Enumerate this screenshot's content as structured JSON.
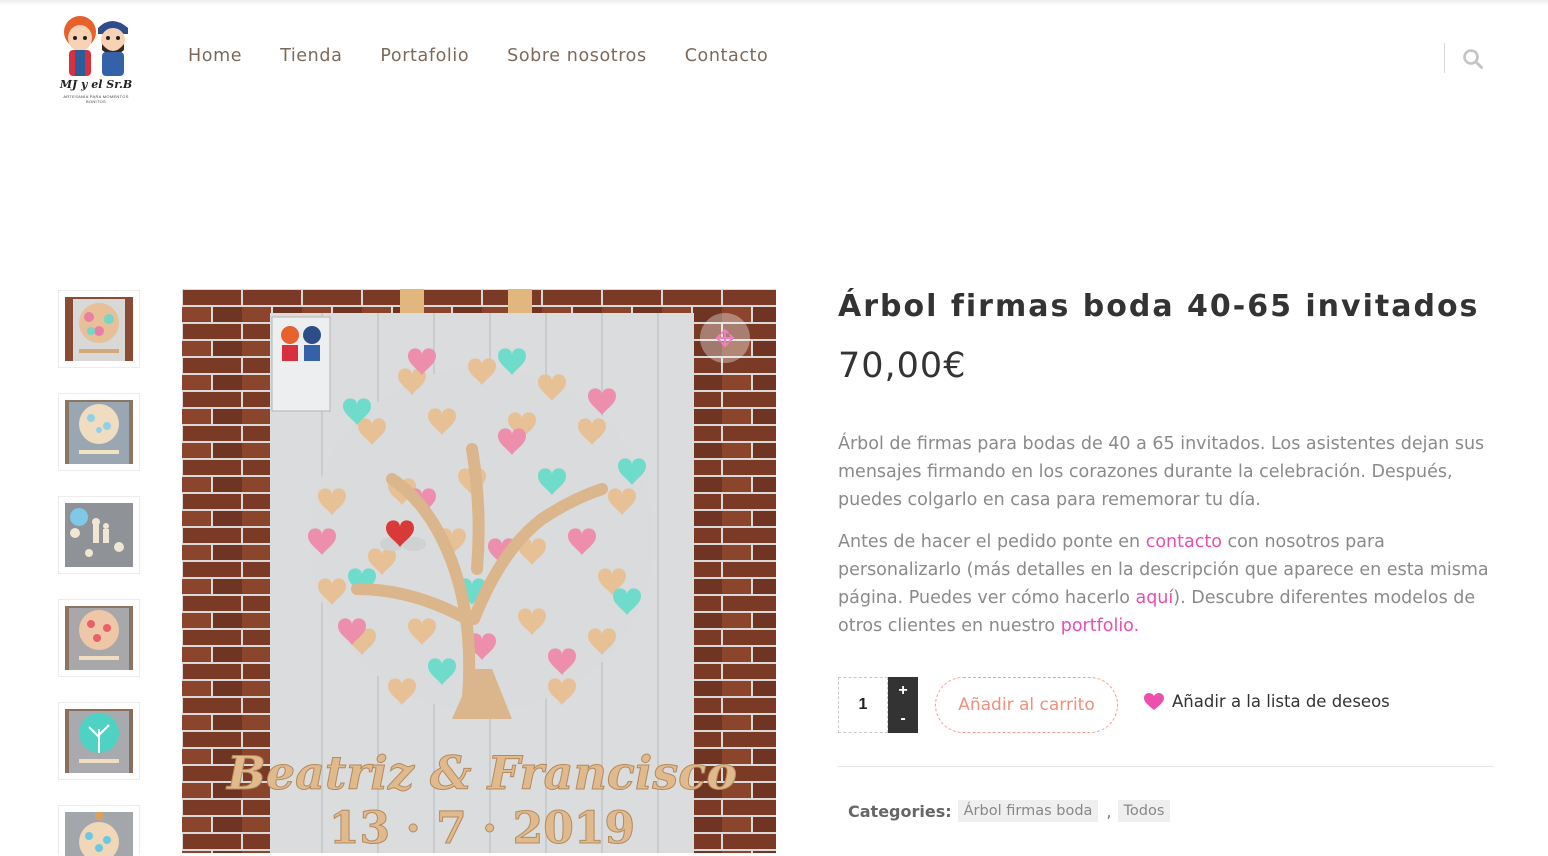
{
  "header": {
    "logo_text": "MJ y el Sr.B",
    "logo_subtext": "ARTESANÍA PARA MOMENTOS BONITOS",
    "nav": [
      "Home",
      "Tienda",
      "Portafolio",
      "Sobre nosotros",
      "Contacto"
    ],
    "search_icon": "search-icon"
  },
  "gallery": {
    "thumbnail_count": 6,
    "main_image_lettering": "Beatriz & Francisco",
    "main_image_date": "13 · 7 · 2019",
    "zoom_icon": "move-arrows-icon"
  },
  "product": {
    "title": "Árbol firmas boda 40-65 invitados",
    "price": "70,00€",
    "desc1": "Árbol de firmas para bodas de 40 a 65 invitados.  Los asistentes dejan sus mensajes firmando en los corazones durante la celebración. Después, puedes colgarlo en casa para rememorar tu día.",
    "desc2_a": "Antes de hacer el pedido ponte en ",
    "desc2_link1": "contacto",
    "desc2_b": " con nosotros para personalizarlo (más detalles en la descripción que aparece en esta misma página. Puedes ver cómo hacerlo ",
    "desc2_link2": "aquí",
    "desc2_c": "). Descubre diferentes modelos de otros clientes en nuestro ",
    "desc2_link3": "portfolio",
    "desc2_d": ".",
    "quantity": "1",
    "qty_plus": "+",
    "qty_minus": "-",
    "add_to_cart": "Añadir al carrito",
    "wishlist": "Añadir a la lista de deseos",
    "categories_label": "Categories:",
    "categories": [
      "Árbol firmas boda",
      "Todos"
    ],
    "categories_separator": ","
  },
  "colors": {
    "accent_pink": "#e64fb0",
    "cart_orange": "#f0907b",
    "text_dark": "#333333",
    "nav_brown": "#7b6a5c"
  }
}
